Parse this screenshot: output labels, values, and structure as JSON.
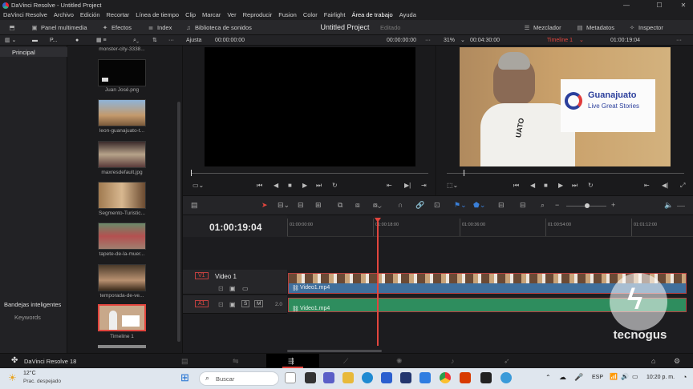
{
  "window": {
    "title": "DaVinci Resolve - Untitled Project"
  },
  "menu": [
    "DaVinci Resolve",
    "Archivo",
    "Edición",
    "Recortar",
    "Línea de tiempo",
    "Clip",
    "Marcar",
    "Ver",
    "Reproducir",
    "Fusion",
    "Color",
    "Fairlight",
    "Área de trabajo",
    "Ayuda"
  ],
  "toolbar": {
    "media_pool": "Panel multimedia",
    "effects": "Efectos",
    "index": "Index",
    "sound_library": "Biblioteca de sonidos",
    "project_title": "Untitled Project",
    "project_status": "Editado",
    "mixer": "Mezclador",
    "metadata": "Metadatos",
    "inspector": "Inspector"
  },
  "subbar": {
    "bin_label": "P...",
    "fit": "Ajusta",
    "src_tc_left": "00:00:00:00",
    "src_tc_right": "00:00:00:00",
    "zoom": "31%",
    "duration": "00:04:30:00",
    "timeline_name": "Timeline 1",
    "rec_tc": "01:00:19:04"
  },
  "bins": {
    "master": "Principal",
    "smart_bins": "Bandejas inteligentes",
    "keywords": "Keywords"
  },
  "media_items": [
    {
      "label": "monster-city-3338..."
    },
    {
      "label": "Juan José.png"
    },
    {
      "label": "leon-guanajuato-t..."
    },
    {
      "label": "maxresdefault.jpg"
    },
    {
      "label": "Segmento-Turistic..."
    },
    {
      "label": "tapete-de-la-muer..."
    },
    {
      "label": "temporada-de-ve..."
    },
    {
      "label": "Timeline 1"
    }
  ],
  "viewer_right": {
    "sign_brand": "Guanajuato",
    "sign_tagline": "Live Great Stories",
    "shirt_text": "UATO"
  },
  "timeline": {
    "timecode": "01:00:19:04",
    "ruler_ticks": [
      "01:00:00:00",
      "01:00:18:00",
      "01:00:36:00",
      "01:00:54:00",
      "01:01:12:00"
    ],
    "ruler_ticks_frac": [
      0.0,
      0.212,
      0.424,
      0.636,
      0.848
    ],
    "playhead_frac": 0.221,
    "video_track": {
      "id": "V1",
      "name": "Video 1"
    },
    "audio_track": {
      "id": "A1",
      "channels": "2.0",
      "solo": "S",
      "mute": "M"
    },
    "video_clip": "Video1.mp4",
    "audio_clip": "Video1.mp4"
  },
  "pagebar": {
    "app_version": "DaVinci Resolve 18"
  },
  "taskbar": {
    "weather_temp": "12°C",
    "weather_desc": "Prac. despejado",
    "search_placeholder": "Buscar",
    "lang": "ESP",
    "time": "10:20 p. m."
  },
  "watermark": "tecnogus",
  "colors": {
    "accent_red": "#e2463e",
    "video_clip": "#3f6f9c",
    "audio_clip": "#2e8d5e"
  }
}
